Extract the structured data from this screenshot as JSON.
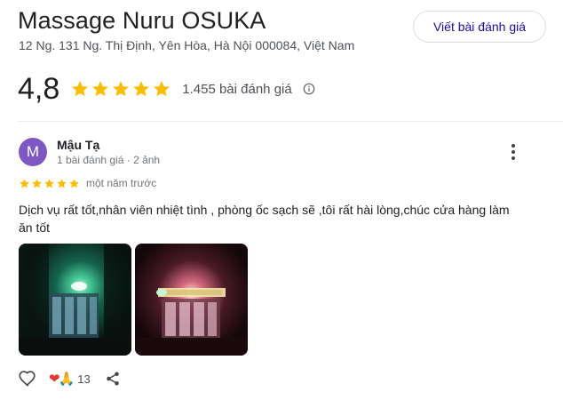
{
  "place": {
    "name": "Massage Nuru OSUKA",
    "address": "12 Ng. 131 Ng. Thị Định, Yên Hòa, Hà Nội 000084, Việt Nam",
    "rating": "4,8",
    "rating_stars": 5,
    "review_count": "1.455 bài đánh giá",
    "write_review_label": "Viết bài đánh giá"
  },
  "review": {
    "avatar_letter": "M",
    "author": "Mậu Tạ",
    "meta": "1 bài đánh giá · 2 ảnh",
    "stars": 5,
    "time": "một năm trước",
    "text": "Dịch vụ rất tốt,nhân viên nhiệt tình , phòng ốc sạch sẽ ,tôi rất hài lòng,chúc cửa hàng làm ăn tốt",
    "photo_count": 2,
    "reaction_count": "13"
  },
  "colors": {
    "star": "#fbbc04",
    "avatar_bg": "#7e57c2",
    "link": "#1a0dab"
  },
  "icons": {
    "info": "info-icon",
    "more": "more-vert-icon",
    "like": "heart-outline-icon",
    "share": "share-icon"
  }
}
